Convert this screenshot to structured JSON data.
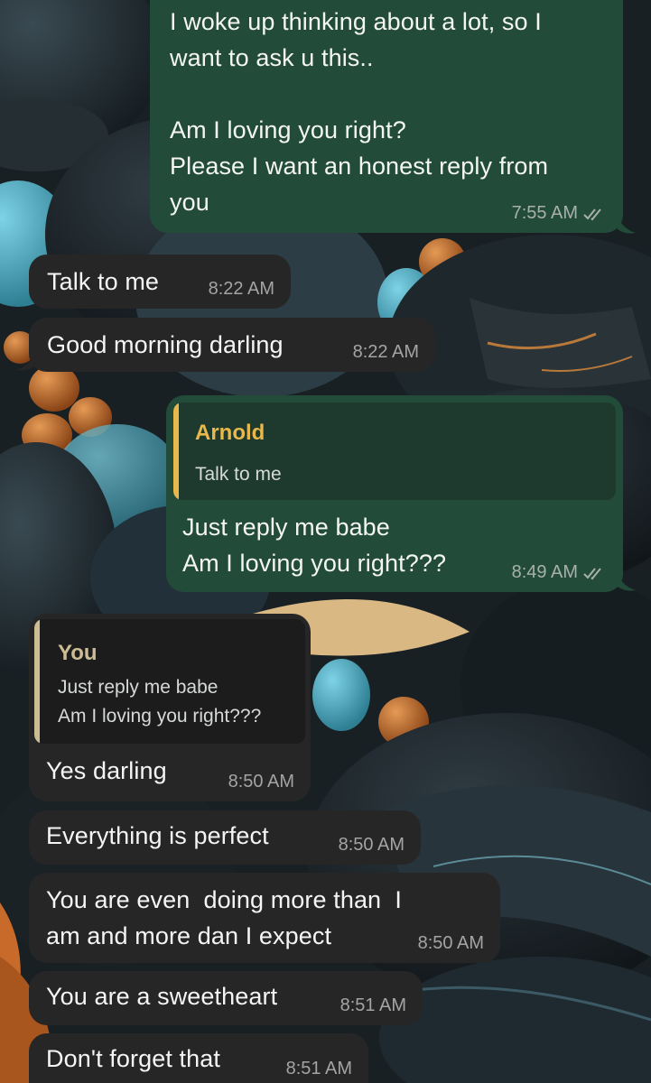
{
  "theme": {
    "outgoing_bubble": "#234b3a",
    "incoming_bubble": "#262626",
    "quote_outgoing_bg": "#1e3a2e",
    "quote_outgoing_accent": "#e8b84a",
    "quote_incoming_bg": "#1c1c1c",
    "quote_incoming_accent": "#cdbd94"
  },
  "messages": [
    {
      "direction": "out",
      "text": "I woke up thinking about a lot, so I\nwant to ask u this..\n\nAm I loving you right?\nPlease I want an honest reply from\nyou",
      "time": "7:55 AM",
      "status": "read-double-check-icon"
    },
    {
      "direction": "in",
      "text": "Talk to me",
      "time": "8:22 AM"
    },
    {
      "direction": "in",
      "text": "Good morning darling",
      "time": "8:22 AM"
    },
    {
      "direction": "out",
      "reply_to": {
        "name": "Arnold",
        "text": "Talk to me"
      },
      "text": "Just reply me babe\nAm I loving you right???",
      "time": "8:49 AM",
      "status": "read-double-check-icon"
    },
    {
      "direction": "in",
      "reply_to": {
        "name": "You",
        "text": "Just reply me babe\nAm I loving you right???"
      },
      "text": "Yes darling",
      "time": "8:50 AM"
    },
    {
      "direction": "in",
      "text": "Everything is perfect",
      "time": "8:50 AM"
    },
    {
      "direction": "in",
      "text": "You are even  doing more than  I\nam and more dan I expect",
      "time": "8:50 AM"
    },
    {
      "direction": "in",
      "text": "You are a sweetheart",
      "time": "8:51 AM"
    },
    {
      "direction": "in",
      "text": "Don't forget that",
      "time": "8:51 AM"
    }
  ]
}
